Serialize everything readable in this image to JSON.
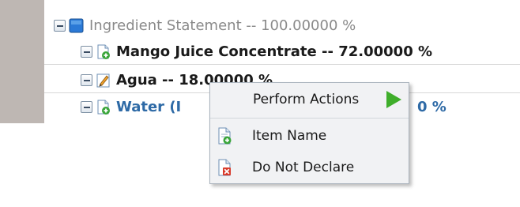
{
  "tree": {
    "rows": [
      {
        "label": "Ingredient Statement -- 100.00000 %"
      },
      {
        "label": "Mango Juice Concentrate -- 72.00000 %"
      },
      {
        "label": "Agua -- 18.00000 %"
      },
      {
        "label": "Water (I"
      },
      {
        "label_tail": "0 %"
      }
    ]
  },
  "context_menu": {
    "header": "Perform Actions",
    "items": [
      {
        "label": "Item Name",
        "icon": "add-document-icon"
      },
      {
        "label": "Do Not Declare",
        "icon": "remove-document-icon"
      }
    ]
  },
  "colors": {
    "accent": "#2e6aa6",
    "arrow": "#3fae2b",
    "gutter": "#beb7b3"
  }
}
